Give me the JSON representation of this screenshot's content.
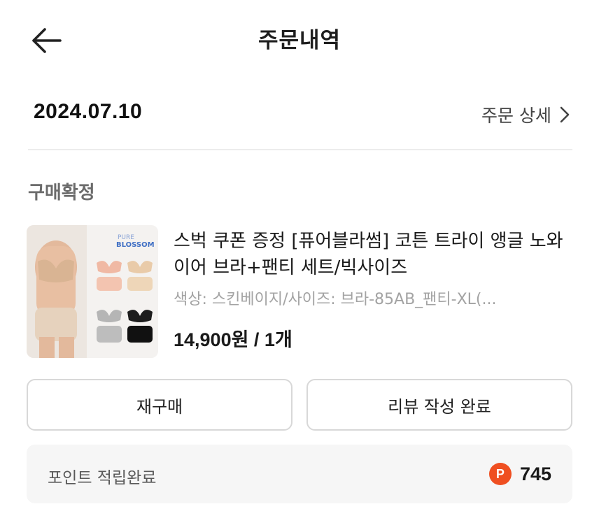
{
  "header": {
    "title": "주문내역",
    "back_icon": "arrow-left-icon"
  },
  "order": {
    "date": "2024.07.10",
    "detail_link": "주문 상세",
    "detail_icon": "chevron-right-icon"
  },
  "status": "구매확정",
  "product": {
    "brand_logo_line1": "PURE",
    "brand_logo_line2": "BLOSSOM",
    "name": "스벅 쿠폰 증정 [퓨어블라썸] 코튼 트라이 앵글 노와이어 브라+팬티 세트/빅사이즈",
    "option": "색상: 스킨베이지/사이즈: 브라-85AB_팬티-XL(...",
    "price": "14,900원 / 1개"
  },
  "actions": {
    "rebuy": "재구매",
    "review": "리뷰 작성 완료"
  },
  "points": {
    "label": "포인트 적립완료",
    "icon_letter": "P",
    "amount": "745",
    "icon_color": "#ef4f21"
  }
}
